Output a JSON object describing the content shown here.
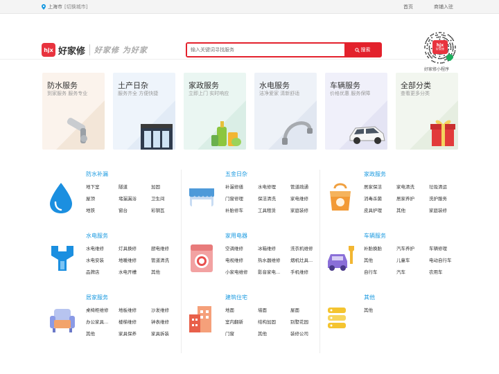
{
  "topbar": {
    "city": "上海市",
    "switch_city": "[切换城市]",
    "links": [
      "首页",
      "商铺入驻"
    ]
  },
  "header": {
    "logo_mark": "hjx",
    "logo_text": "好家修",
    "slogan": "好家修 为好家",
    "search_placeholder": "输入关键词寻找服务",
    "search_button": "搜索",
    "qr_badge": "好家修",
    "qr_caption": "好家修小程序"
  },
  "service_cards": [
    {
      "title": "防水服务",
      "subtitle": "到家服务 服务专业"
    },
    {
      "title": "土产日杂",
      "subtitle": "服务齐全 方便快捷"
    },
    {
      "title": "家政服务",
      "subtitle": "立即上门 实时响应"
    },
    {
      "title": "水电服务",
      "subtitle": "洁净爱家 清新舒适"
    },
    {
      "title": "车辆服务",
      "subtitle": "价格优惠 服务保障"
    },
    {
      "title": "全部分类",
      "subtitle": "查看更多分类"
    }
  ],
  "categories": [
    {
      "name": "防水补漏",
      "icon": "water-drop-icon",
      "items": [
        "卫生间",
        "地下室",
        "隧道",
        "加固",
        "屋顶",
        "堵漏漏浴",
        "地铁",
        "窗台",
        "彩钢瓦"
      ]
    },
    {
      "name": "五金日杂",
      "icon": "shop-awning-icon",
      "items": [
        "补漏修缮",
        "水电修理",
        "管道疏通",
        "门窗修理",
        "保洁清洗",
        "家电维修",
        "补胎修车",
        "工具租赁",
        "家庭装修"
      ]
    },
    {
      "name": "家政服务",
      "icon": "cleaning-bag-icon",
      "items": [
        "居家保洁",
        "家电清洗",
        "垃圾清运",
        "消毒杀菌",
        "居家养护",
        "洗护服务",
        "皮具护理",
        "其他",
        "家庭装修"
      ]
    },
    {
      "name": "水电服务",
      "icon": "wrench-icon",
      "items": [
        "水电维修",
        "灯具换修",
        "厨电维修",
        "水电安装",
        "地暖维修",
        "管道清洗",
        "品牌店",
        "水电开槽",
        "其他"
      ]
    },
    {
      "name": "家用电器",
      "icon": "washing-machine-icon",
      "items": [
        "空调维修",
        "冰箱维修",
        "洗衣机维修",
        "电视维修",
        "热水器维修",
        "烟机灶具...",
        "小家电维修",
        "影音家电...",
        "手机维修"
      ]
    },
    {
      "name": "车辆服务",
      "icon": "car-wrench-icon",
      "items": [
        "补胎换胎",
        "汽车养护",
        "车辆修理",
        "其他",
        "儿童车",
        "电动自行车",
        "自行车",
        "汽车",
        "农用车"
      ]
    },
    {
      "name": "居家服务",
      "icon": "sofa-icon",
      "items": [
        "桌椅柜维修",
        "地板维修",
        "沙发维修",
        "办公家具...",
        "楼梯维修",
        "钟表维修",
        "其他",
        "家具保养",
        "家具拆装"
      ]
    },
    {
      "name": "建筑住宅",
      "icon": "building-icon",
      "items": [
        "地面",
        "墙面",
        "屋面",
        "室内翻新",
        "结构加固",
        "别墅花园",
        "门窗",
        "其他",
        "装修公司"
      ]
    },
    {
      "name": "其他",
      "icon": "stack-icon",
      "items": [
        "其他"
      ]
    }
  ]
}
